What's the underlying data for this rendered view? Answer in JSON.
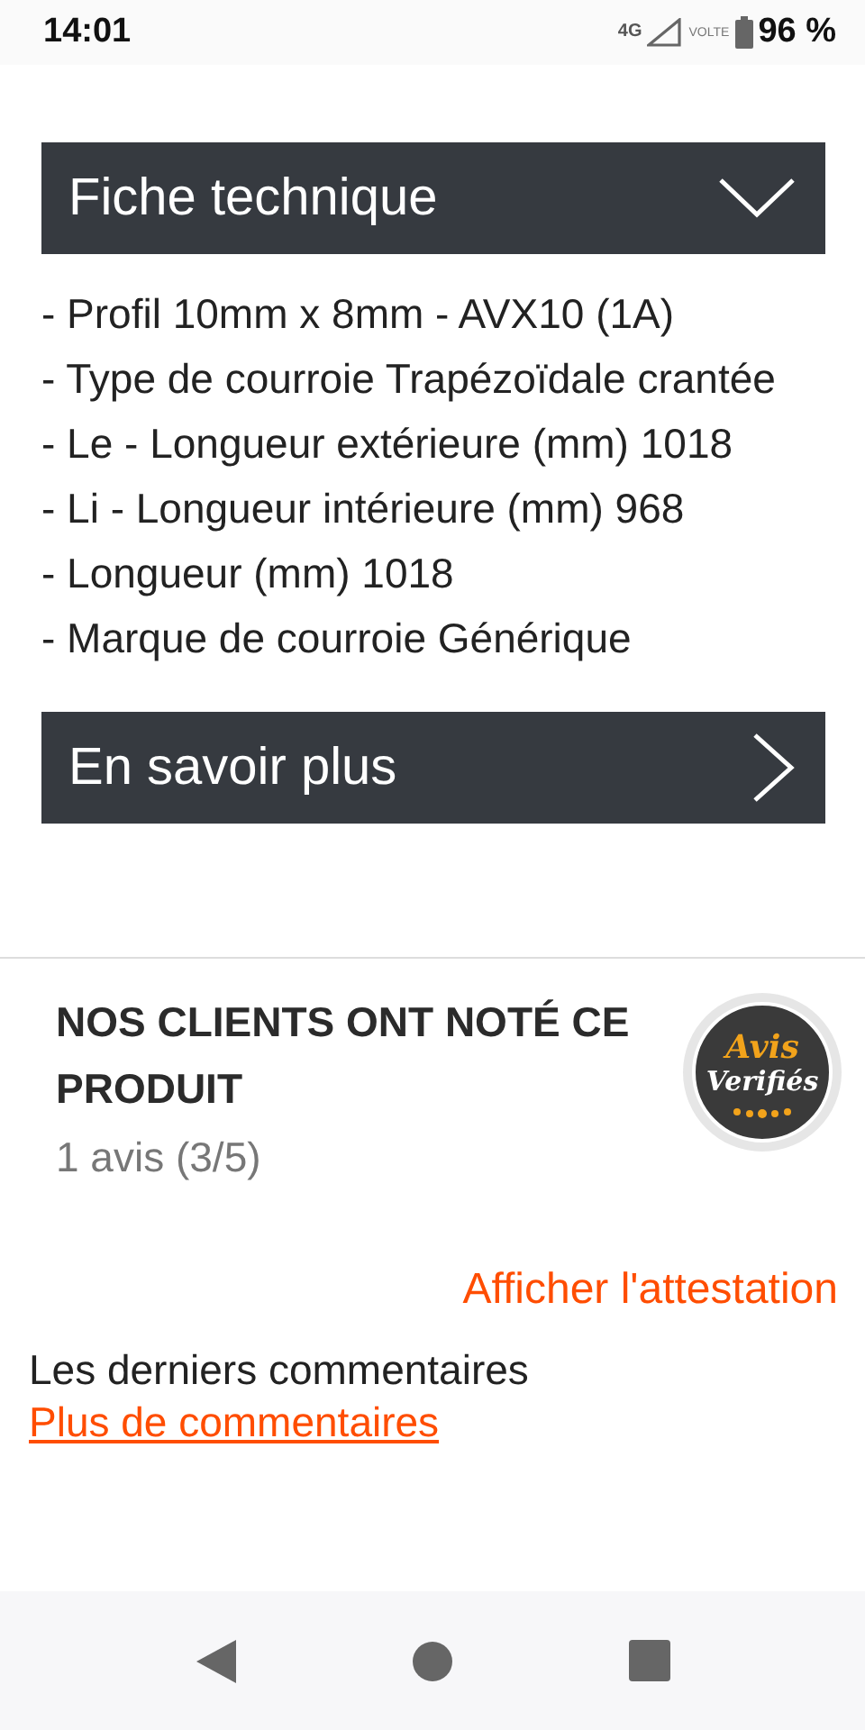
{
  "status_bar": {
    "time": "14:01",
    "network": "4G",
    "volte": "VOLTE",
    "battery": "96 %"
  },
  "sections": [
    {
      "title": "Fiche technique",
      "expanded": true,
      "lines": [
        "- Profil 10mm x 8mm - AVX10 (1A)",
        "- Type de courroie Trapézoïdale crantée",
        "- Le - Longueur extérieure (mm) 1018",
        "- Li - Longueur intérieure (mm) 968",
        "- Longueur (mm) 1018",
        "- Marque de courroie Générique"
      ]
    },
    {
      "title": "En savoir plus",
      "expanded": false
    }
  ],
  "reviews": {
    "heading": "NOS CLIENTS ONT NOTÉ CE PRODUIT",
    "summary": "1 avis (3/5)",
    "badge": {
      "line_1": "Avis",
      "line_2": "Verifiés"
    },
    "attestation_link": "Afficher l'attestation",
    "comments_title": "Les derniers commentaires",
    "more_link": "Plus de commentaires"
  }
}
